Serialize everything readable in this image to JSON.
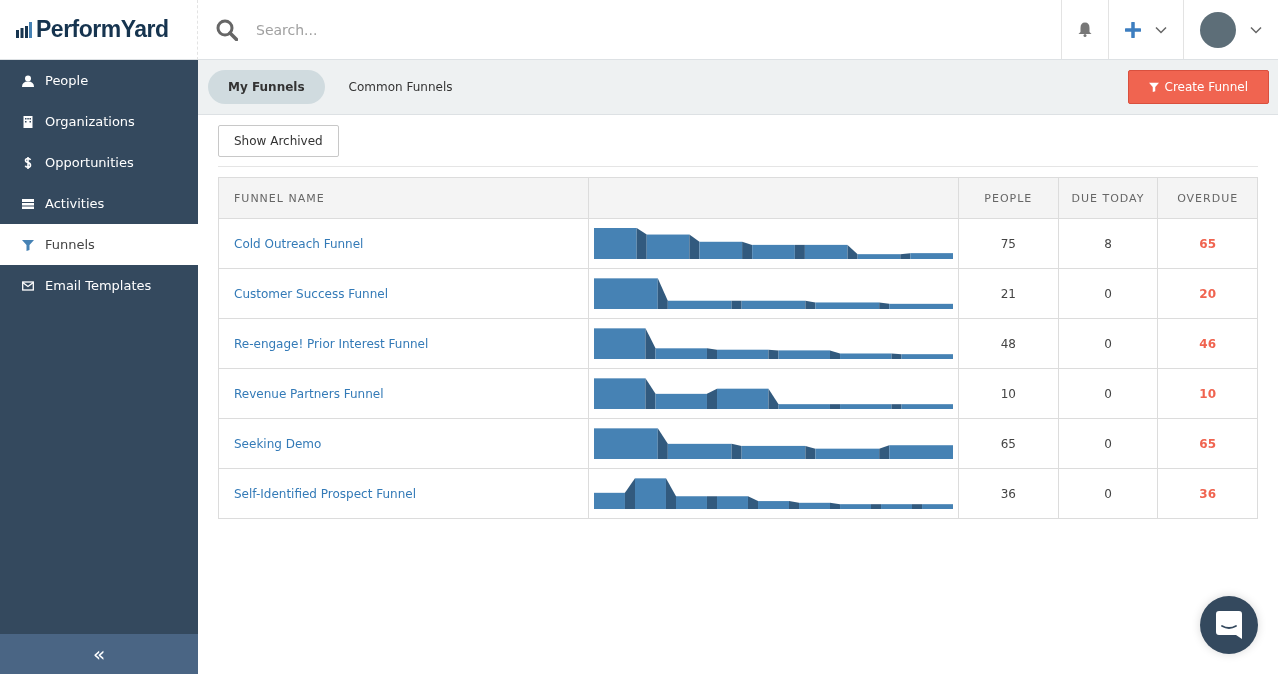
{
  "logo": {
    "text": "PerformYard"
  },
  "search": {
    "placeholder": "Search..."
  },
  "sidebar": {
    "items": [
      {
        "label": "People",
        "selected": false
      },
      {
        "label": "Organizations",
        "selected": false
      },
      {
        "label": "Opportunities",
        "selected": false
      },
      {
        "label": "Activities",
        "selected": false
      },
      {
        "label": "Funnels",
        "selected": true
      },
      {
        "label": "Email Templates",
        "selected": false
      }
    ],
    "collapse": "«"
  },
  "tabs": [
    {
      "label": "My Funnels",
      "selected": true
    },
    {
      "label": "Common Funnels",
      "selected": false
    }
  ],
  "create_button": "Create Funnel",
  "show_archived": "Show Archived",
  "table": {
    "columns": [
      "FUNNEL NAME",
      "PEOPLE",
      "DUE TODAY",
      "OVERDUE"
    ],
    "rows": [
      {
        "name": "Cold Outreach Funnel",
        "people": "75",
        "due_today": "8",
        "overdue": "65"
      },
      {
        "name": "Customer Success Funnel",
        "people": "21",
        "due_today": "0",
        "overdue": "20"
      },
      {
        "name": "Re-engage! Prior Interest Funnel",
        "people": "48",
        "due_today": "0",
        "overdue": "46"
      },
      {
        "name": "Revenue Partners Funnel",
        "people": "10",
        "due_today": "0",
        "overdue": "10"
      },
      {
        "name": "Seeking Demo",
        "people": "65",
        "due_today": "0",
        "overdue": "65"
      },
      {
        "name": "Self-Identified Prospect Funnel",
        "people": "36",
        "due_today": "0",
        "overdue": "36"
      }
    ]
  }
}
